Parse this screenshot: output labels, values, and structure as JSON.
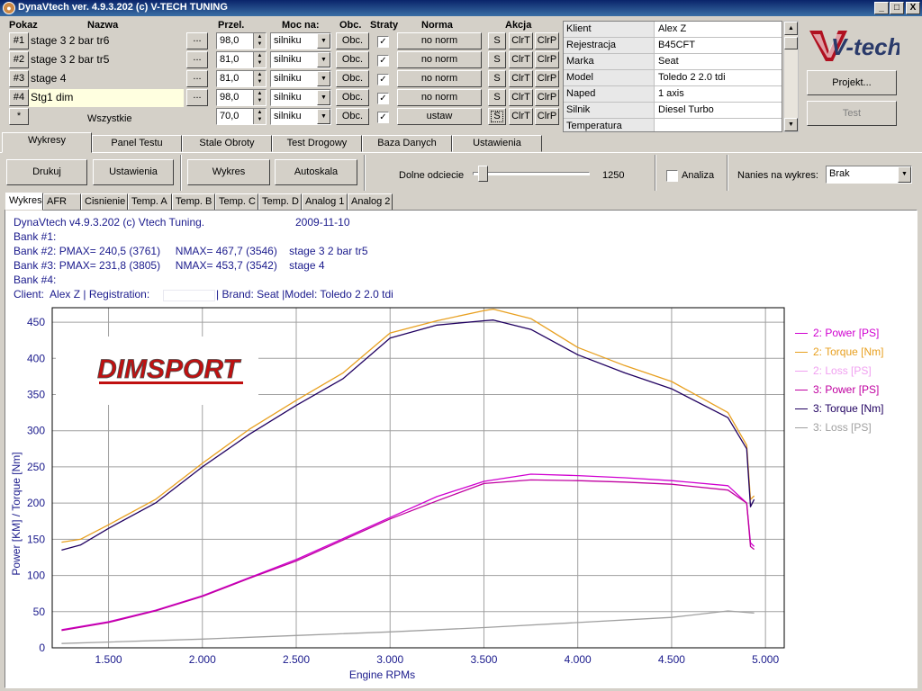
{
  "window": {
    "title": "DynaVtech ver. 4.9.3.202 (c) V-TECH TUNING",
    "min_label": "_",
    "max_label": "□",
    "close_label": "X"
  },
  "grid_headers": {
    "pokaz": "Pokaz",
    "nazwa": "Nazwa",
    "przel": "Przel.",
    "moc_na": "Moc na:",
    "obc": "Obc.",
    "straty": "Straty",
    "norma": "Norma",
    "akcja": "Akcja"
  },
  "runs": [
    {
      "num": "#1",
      "name": "stage 3 2 bar tr6",
      "dots": "...",
      "przel": "98,0",
      "moc": "silniku",
      "obc": "Obc.",
      "straty": true,
      "norma": "no norm",
      "s": "S",
      "clrt": "ClrT",
      "clrp": "ClrP"
    },
    {
      "num": "#2",
      "name": "stage 3 2 bar tr5",
      "dots": "...",
      "przel": "81,0",
      "moc": "silniku",
      "obc": "Obc.",
      "straty": true,
      "norma": "no norm",
      "s": "S",
      "clrt": "ClrT",
      "clrp": "ClrP"
    },
    {
      "num": "#3",
      "name": "stage 4",
      "dots": "...",
      "przel": "81,0",
      "moc": "silniku",
      "obc": "Obc.",
      "straty": true,
      "norma": "no norm",
      "s": "S",
      "clrt": "ClrT",
      "clrp": "ClrP"
    },
    {
      "num": "#4",
      "name": "Stg1 dim",
      "dots": "...",
      "przel": "98,0",
      "moc": "silniku",
      "obc": "Obc.",
      "straty": true,
      "norma": "no norm",
      "s": "S",
      "clrt": "ClrT",
      "clrp": "ClrP"
    }
  ],
  "all_row": {
    "star": "*",
    "label": "Wszystkie",
    "przel": "70,0",
    "moc": "silniku",
    "obc": "Obc.",
    "straty": true,
    "norma": "ustaw",
    "s": "S",
    "clrt": "ClrT",
    "clrp": "ClrP"
  },
  "info": [
    {
      "key": "Klient",
      "value": "Alex Z"
    },
    {
      "key": "Rejestracja",
      "value": "B45CFT"
    },
    {
      "key": "Marka",
      "value": "Seat"
    },
    {
      "key": "Model",
      "value": "Toledo 2 2.0 tdi"
    },
    {
      "key": "Naped",
      "value": "1 axis"
    },
    {
      "key": "Silnik",
      "value": "Diesel Turbo"
    },
    {
      "key": "Temperatura",
      "value": ""
    }
  ],
  "logo_text": "V-tech",
  "side_buttons": {
    "projekt": "Projekt...",
    "test": "Test"
  },
  "main_tabs": [
    "Wykresy",
    "Panel Testu",
    "Stale Obroty",
    "Test Drogowy",
    "Baza Danych",
    "Ustawienia"
  ],
  "toolbar": {
    "drukuj": "Drukuj",
    "ustawienia": "Ustawienia",
    "wykres": "Wykres",
    "autoskala": "Autoskala",
    "dolne_label": "Dolne odciecie",
    "dolne_value": "1250",
    "dolne_level": 0.05,
    "analiza": "Analiza",
    "nanies_label": "Nanies na wykres:",
    "nanies_value": "Brak"
  },
  "sub_tabs": [
    "Wykres",
    "AFR",
    "Cisnienie",
    "Temp. A",
    "Temp. B",
    "Temp. C",
    "Temp. D",
    "Analog 1",
    "Analog 2"
  ],
  "info_lines": {
    "header": "DynaVtech v4.9.3.202 (c) Vtech Tuning.",
    "date": "2009-11-10",
    "bank1": "Bank #1:",
    "bank2": "Bank #2: PMAX= 240,5 (3761)     NMAX= 467,7 (3546)    stage 3 2 bar tr5",
    "bank3": "Bank #3: PMAX= 231,8 (3805)     NMAX= 453,7 (3542)    stage 4",
    "bank4": "Bank #4:",
    "client": "Client:  Alex Z | Registration:",
    "client2": "| Brand: Seat |Model: Toledo 2 2.0 tdi"
  },
  "watermark": "DIMSPORT",
  "chart_data": {
    "type": "line",
    "xlabel": "Engine RPMs",
    "ylabel": "Power [KM] / Torque [Nm]",
    "xlim": [
      1200,
      5100
    ],
    "ylim": [
      0,
      470
    ],
    "xticks": [
      "1.500",
      "2.000",
      "2.500",
      "3.000",
      "3.500",
      "4.000",
      "4.500",
      "5.000"
    ],
    "xtick_values": [
      1500,
      2000,
      2500,
      3000,
      3500,
      4000,
      4500,
      5000
    ],
    "yticks": [
      0,
      50,
      100,
      150,
      200,
      250,
      300,
      350,
      400,
      450
    ],
    "grid": true,
    "series": [
      {
        "name": "2: Power [PS]",
        "color": "#d000d0",
        "x": [
          1250,
          1500,
          1750,
          2000,
          2250,
          2500,
          2750,
          3000,
          3250,
          3500,
          3750,
          4000,
          4250,
          4500,
          4800,
          4900,
          4920,
          4940
        ],
        "y": [
          25,
          36,
          52,
          72,
          97,
          122,
          151,
          180,
          209,
          230,
          240,
          238,
          235,
          231,
          224,
          200,
          145,
          140
        ]
      },
      {
        "name": "2: Torque [Nm]",
        "color": "#e8a020",
        "x": [
          1250,
          1350,
          1500,
          1750,
          2000,
          2250,
          2500,
          2750,
          3000,
          3250,
          3500,
          3550,
          3750,
          4000,
          4250,
          4500,
          4800,
          4900,
          4920,
          4940
        ],
        "y": [
          146,
          150,
          170,
          205,
          255,
          302,
          342,
          380,
          435,
          452,
          466,
          468,
          455,
          415,
          390,
          368,
          325,
          280,
          205,
          210
        ]
      },
      {
        "name": "2: Loss [PS]",
        "color": "#f0a0f0",
        "x": [],
        "y": []
      },
      {
        "name": "3: Power [PS]",
        "color": "#c000a0",
        "x": [
          1250,
          1500,
          1750,
          2000,
          2250,
          2500,
          2750,
          3000,
          3250,
          3500,
          3750,
          4000,
          4250,
          4500,
          4800,
          4900,
          4920,
          4940
        ],
        "y": [
          24,
          35,
          51,
          71,
          96,
          120,
          149,
          178,
          203,
          227,
          232,
          231,
          229,
          226,
          218,
          200,
          140,
          136
        ]
      },
      {
        "name": "3: Torque [Nm]",
        "color": "#200060",
        "x": [
          1250,
          1350,
          1500,
          1750,
          2000,
          2250,
          2500,
          2750,
          3000,
          3250,
          3500,
          3550,
          3750,
          4000,
          4250,
          4500,
          4800,
          4900,
          4920,
          4940
        ],
        "y": [
          135,
          142,
          165,
          200,
          250,
          295,
          335,
          372,
          428,
          446,
          452,
          453,
          440,
          405,
          380,
          358,
          318,
          275,
          195,
          205
        ]
      },
      {
        "name": "3: Loss [PS]",
        "color": "#a0a0a0",
        "x": [
          1250,
          1500,
          2000,
          2500,
          3000,
          3500,
          4000,
          4500,
          4800,
          4940
        ],
        "y": [
          6,
          8,
          12,
          17,
          22,
          28,
          35,
          42,
          51,
          48
        ]
      }
    ]
  }
}
